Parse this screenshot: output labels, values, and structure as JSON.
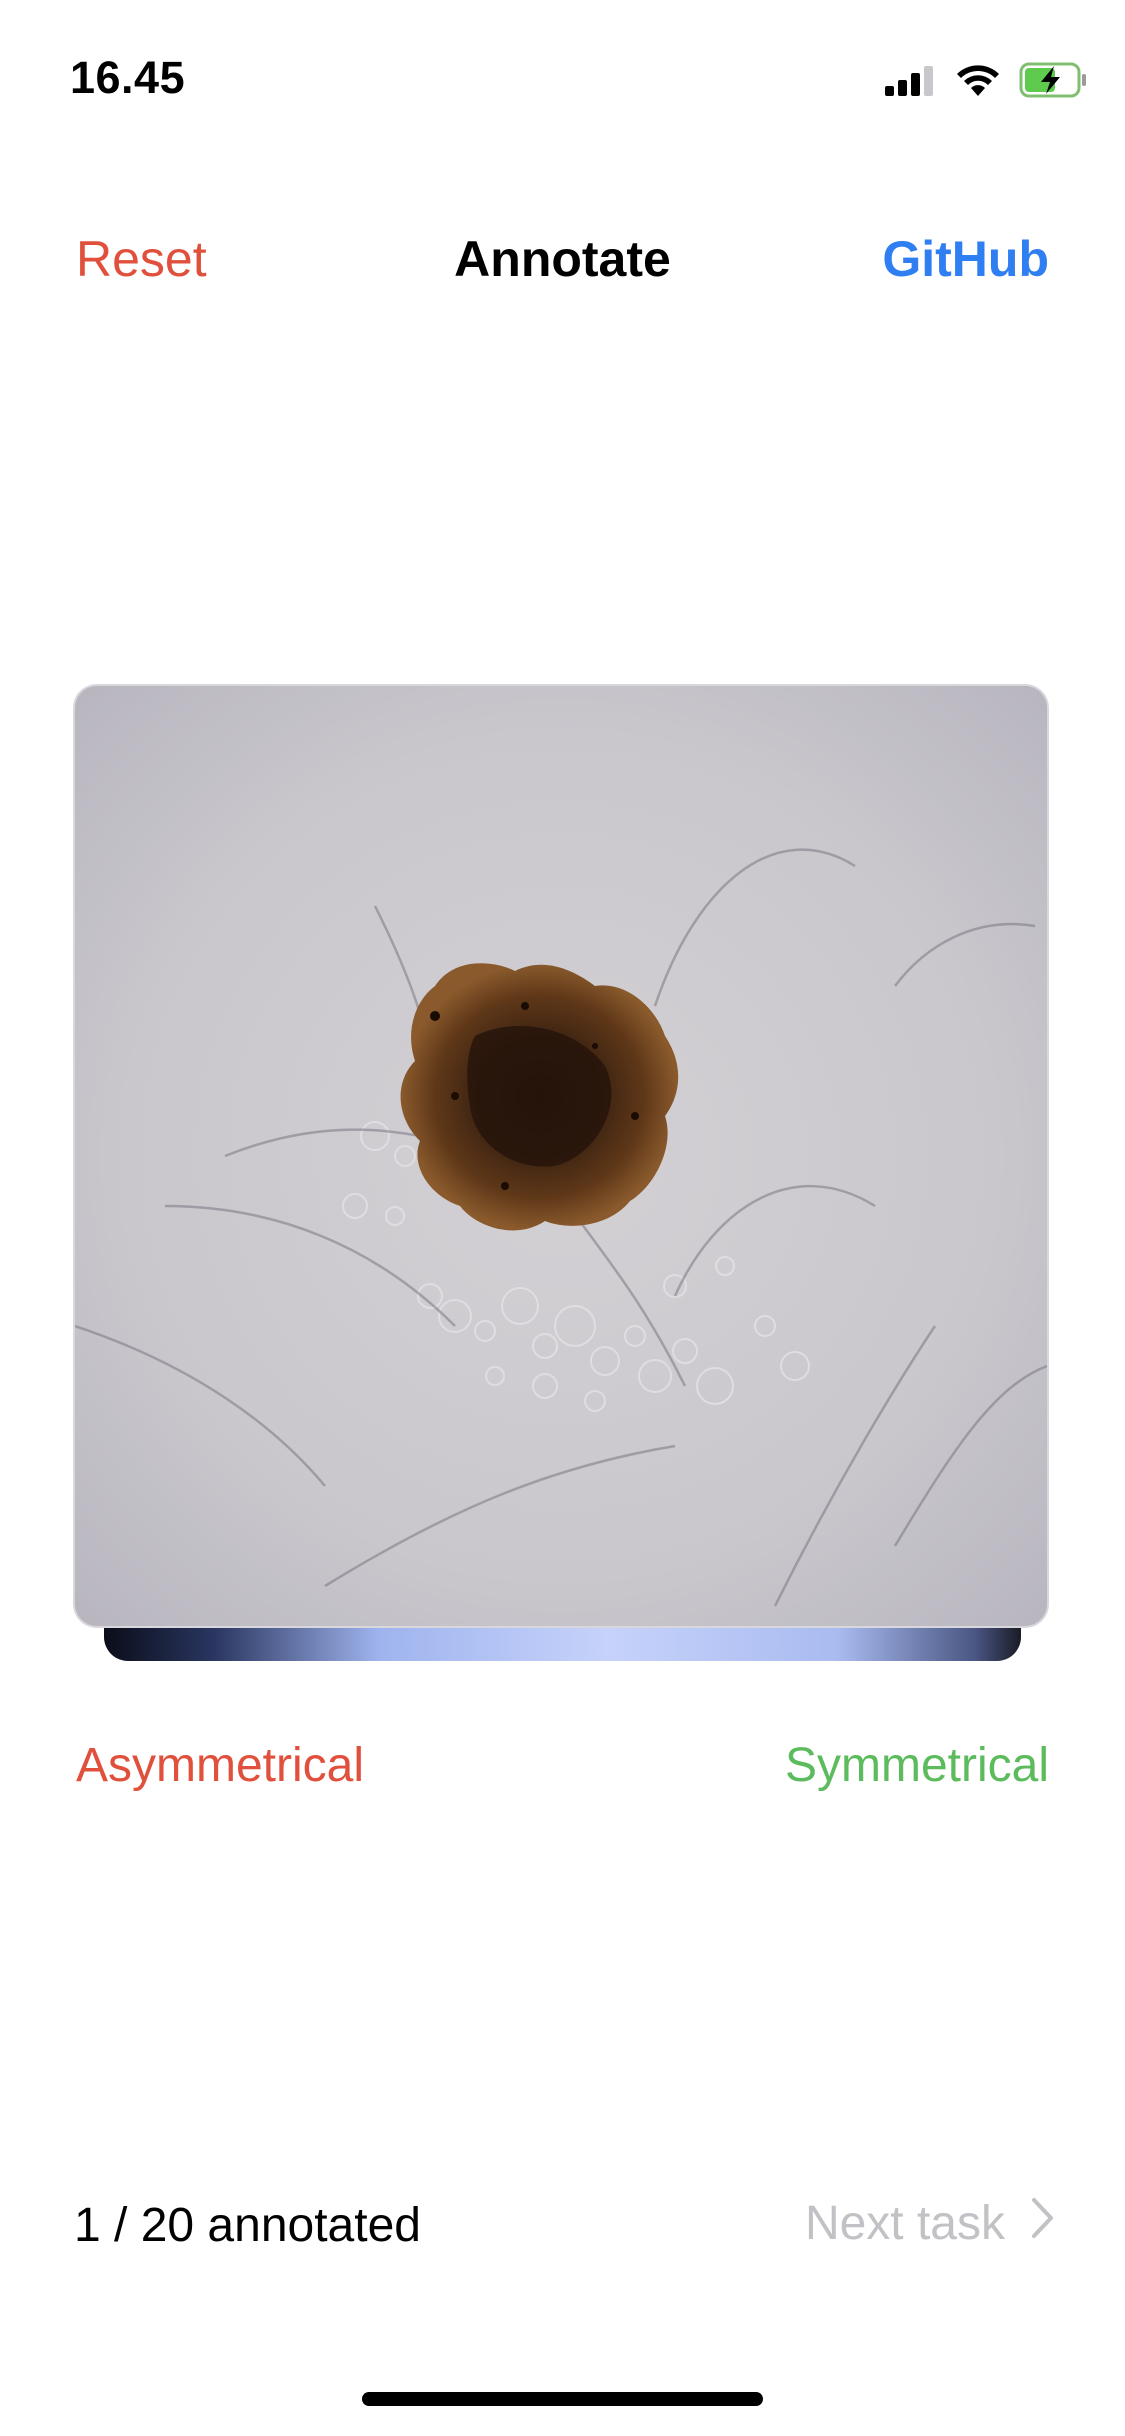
{
  "status_bar": {
    "time": "16.45",
    "icons": [
      "cellular-signal-icon",
      "wifi-icon",
      "battery-charging-icon"
    ]
  },
  "nav": {
    "reset_label": "Reset",
    "title": "Annotate",
    "github_label": "GitHub"
  },
  "card": {
    "image": "dermoscopy-lesion-image"
  },
  "swipe_labels": {
    "left": "Asymmetrical",
    "right": "Symmetrical"
  },
  "footer": {
    "progress": "1 / 20 annotated",
    "next_label": "Next task"
  },
  "colors": {
    "reset": "#e0503c",
    "github": "#2f7ef2",
    "asymmetrical": "#e0503c",
    "symmetrical": "#5cbb5c",
    "disabled": "#c2c2c6"
  }
}
